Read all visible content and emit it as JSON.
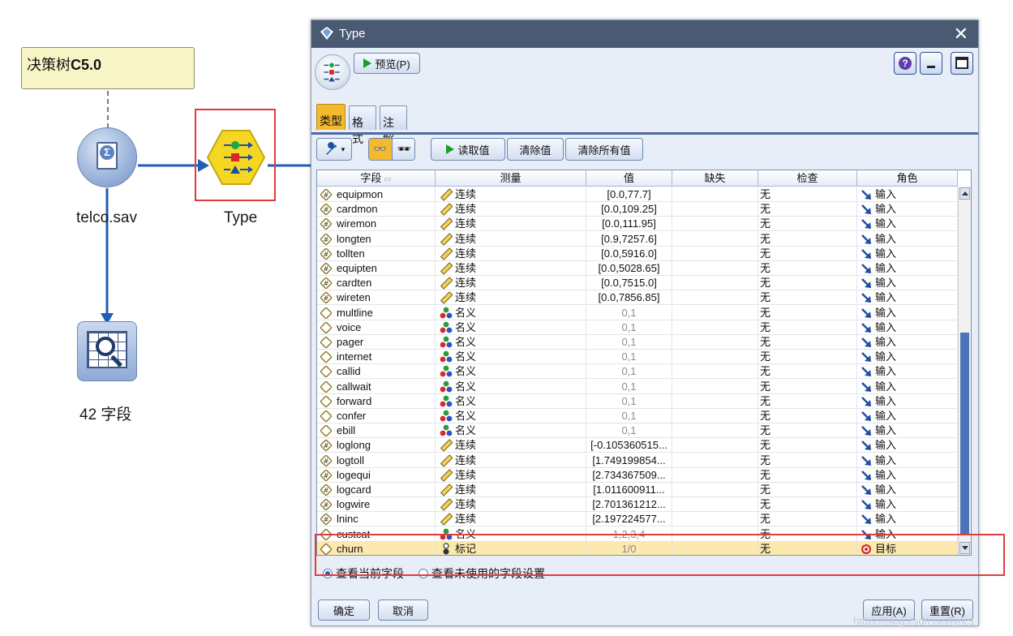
{
  "canvas": {
    "comment_prefix": "决策树",
    "comment_bold": "C5.0",
    "source_node_label": "telco.sav",
    "type_node_label": "Type",
    "table_node_label": "42 字段"
  },
  "dialog": {
    "title": "Type",
    "preview_label": "预览(P)",
    "tabs": [
      "类型",
      "格式",
      "注解"
    ],
    "read_values_label": "读取值",
    "clear_values_label": "清除值",
    "clear_all_values_label": "清除所有值",
    "columns": [
      "字段",
      "测量",
      "值",
      "缺失",
      "检查",
      "角色"
    ],
    "rows": [
      {
        "field": "equipmon",
        "measure": "连续",
        "value": "[0.0,77.7]",
        "missing": "",
        "check": "无",
        "role": "输入",
        "kind": "cont"
      },
      {
        "field": "cardmon",
        "measure": "连续",
        "value": "[0.0,109.25]",
        "missing": "",
        "check": "无",
        "role": "输入",
        "kind": "cont"
      },
      {
        "field": "wiremon",
        "measure": "连续",
        "value": "[0.0,111.95]",
        "missing": "",
        "check": "无",
        "role": "输入",
        "kind": "cont"
      },
      {
        "field": "longten",
        "measure": "连续",
        "value": "[0.9,7257.6]",
        "missing": "",
        "check": "无",
        "role": "输入",
        "kind": "cont"
      },
      {
        "field": "tollten",
        "measure": "连续",
        "value": "[0.0,5916.0]",
        "missing": "",
        "check": "无",
        "role": "输入",
        "kind": "cont"
      },
      {
        "field": "equipten",
        "measure": "连续",
        "value": "[0.0,5028.65]",
        "missing": "",
        "check": "无",
        "role": "输入",
        "kind": "cont"
      },
      {
        "field": "cardten",
        "measure": "连续",
        "value": "[0.0,7515.0]",
        "missing": "",
        "check": "无",
        "role": "输入",
        "kind": "cont"
      },
      {
        "field": "wireten",
        "measure": "连续",
        "value": "[0.0,7856.85]",
        "missing": "",
        "check": "无",
        "role": "输入",
        "kind": "cont"
      },
      {
        "field": "multline",
        "measure": "名义",
        "value": "0,1",
        "missing": "",
        "check": "无",
        "role": "输入",
        "kind": "nom"
      },
      {
        "field": "voice",
        "measure": "名义",
        "value": "0,1",
        "missing": "",
        "check": "无",
        "role": "输入",
        "kind": "nom"
      },
      {
        "field": "pager",
        "measure": "名义",
        "value": "0,1",
        "missing": "",
        "check": "无",
        "role": "输入",
        "kind": "nom"
      },
      {
        "field": "internet",
        "measure": "名义",
        "value": "0,1",
        "missing": "",
        "check": "无",
        "role": "输入",
        "kind": "nom"
      },
      {
        "field": "callid",
        "measure": "名义",
        "value": "0,1",
        "missing": "",
        "check": "无",
        "role": "输入",
        "kind": "nom"
      },
      {
        "field": "callwait",
        "measure": "名义",
        "value": "0,1",
        "missing": "",
        "check": "无",
        "role": "输入",
        "kind": "nom"
      },
      {
        "field": "forward",
        "measure": "名义",
        "value": "0,1",
        "missing": "",
        "check": "无",
        "role": "输入",
        "kind": "nom"
      },
      {
        "field": "confer",
        "measure": "名义",
        "value": "0,1",
        "missing": "",
        "check": "无",
        "role": "输入",
        "kind": "nom"
      },
      {
        "field": "ebill",
        "measure": "名义",
        "value": "0,1",
        "missing": "",
        "check": "无",
        "role": "输入",
        "kind": "nom"
      },
      {
        "field": "loglong",
        "measure": "连续",
        "value": "[-0.105360515...",
        "missing": "",
        "check": "无",
        "role": "输入",
        "kind": "cont"
      },
      {
        "field": "logtoll",
        "measure": "连续",
        "value": "[1.749199854...",
        "missing": "",
        "check": "无",
        "role": "输入",
        "kind": "cont"
      },
      {
        "field": "logequi",
        "measure": "连续",
        "value": "[2.734367509...",
        "missing": "",
        "check": "无",
        "role": "输入",
        "kind": "cont"
      },
      {
        "field": "logcard",
        "measure": "连续",
        "value": "[1.011600911...",
        "missing": "",
        "check": "无",
        "role": "输入",
        "kind": "cont"
      },
      {
        "field": "logwire",
        "measure": "连续",
        "value": "[2.701361212...",
        "missing": "",
        "check": "无",
        "role": "输入",
        "kind": "cont"
      },
      {
        "field": "lninc",
        "measure": "连续",
        "value": "[2.197224577...",
        "missing": "",
        "check": "无",
        "role": "输入",
        "kind": "cont"
      },
      {
        "field": "custcat",
        "measure": "名义",
        "value": "1,2,3,4",
        "missing": "",
        "check": "无",
        "role": "输入",
        "kind": "nom"
      },
      {
        "field": "churn",
        "measure": "标记",
        "value": "1/0",
        "missing": "",
        "check": "无",
        "role": "目标",
        "kind": "flag",
        "highlight": true
      }
    ],
    "radio_current": "查看当前字段",
    "radio_unused": "查看未使用的字段设置",
    "ok_label": "确定",
    "cancel_label": "取消",
    "apply_label": "应用(A)",
    "reset_label": "重置(R)"
  },
  "watermark": "https://blog.csdn.net/lyric1",
  "colors": {
    "accent_tab": "#f3ba2d",
    "highlight_row": "#fbe9ad",
    "annotation_red": "#e33b3b",
    "titlebar": "#4a5a72"
  }
}
